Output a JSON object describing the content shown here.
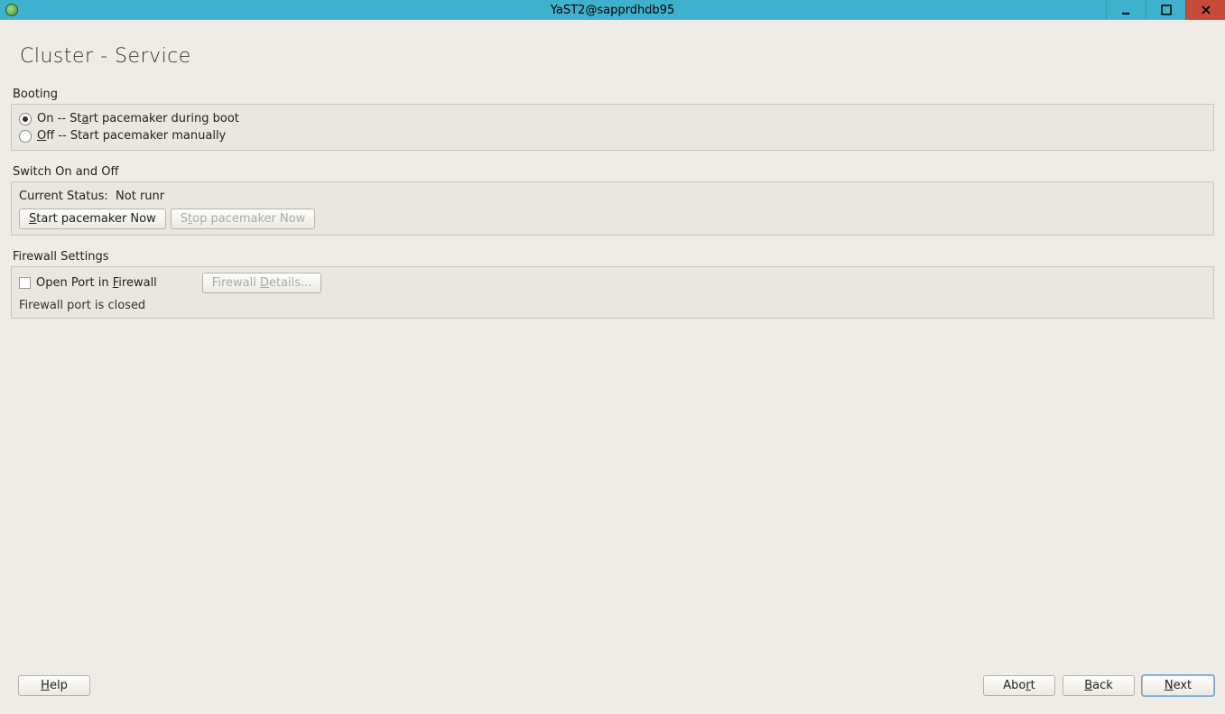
{
  "window": {
    "title": "YaST2@sapprdhdb95"
  },
  "page": {
    "title": "Cluster - Service"
  },
  "booting": {
    "label": "Booting",
    "on_prefix": "On -- St",
    "on_u": "a",
    "on_suffix": "rt pacemaker during boot",
    "off_u": "O",
    "off_suffix": "ff -- Start pacemaker manually",
    "selected": "on"
  },
  "switch": {
    "label": "Switch On and Off",
    "status_label": "Current Status:",
    "status_value": "Not runr",
    "start_u": "S",
    "start_suffix": "tart pacemaker Now",
    "stop_prefix": "S",
    "stop_u": "t",
    "stop_suffix": "op pacemaker Now"
  },
  "firewall": {
    "label": "Firewall Settings",
    "open_prefix": "Open Port in ",
    "open_u": "F",
    "open_suffix": "irewall",
    "details_prefix": "Firewall ",
    "details_u": "D",
    "details_suffix": "etails...",
    "status": "Firewall port is closed"
  },
  "buttons": {
    "help_u": "H",
    "help_suffix": "elp",
    "abort_prefix": "Abo",
    "abort_u": "r",
    "abort_suffix": "t",
    "back_u": "B",
    "back_suffix": "ack",
    "next_u": "N",
    "next_suffix": "ext"
  }
}
